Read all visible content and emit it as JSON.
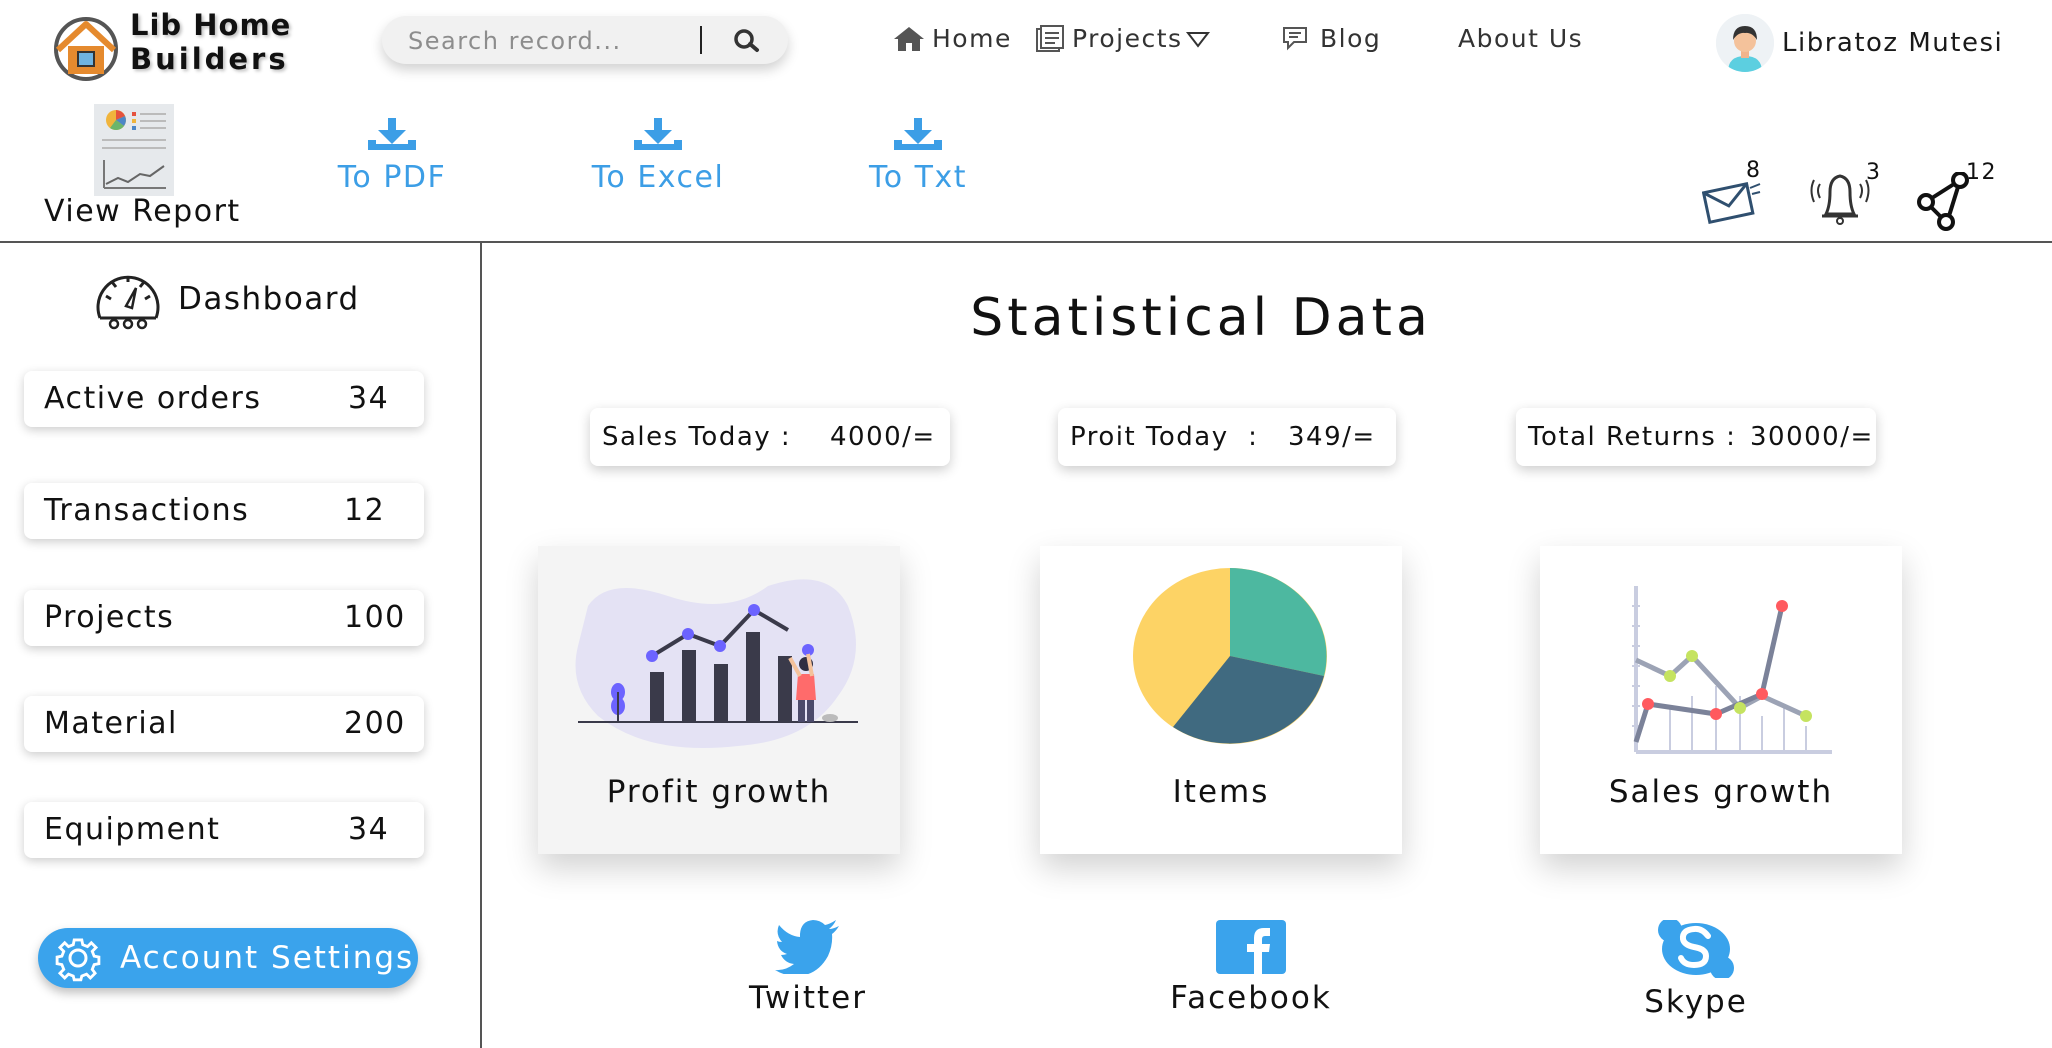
{
  "brand": {
    "line1": "Lib Home",
    "line2": "Builders",
    "icon": "house-logo-icon"
  },
  "search": {
    "placeholder": "Search record...",
    "value": "",
    "icon": "search-icon"
  },
  "nav": {
    "home": "Home",
    "projects": "Projects",
    "blog": "Blog",
    "about": "About Us"
  },
  "user": {
    "name": "Libratoz Mutesi",
    "icon": "user-avatar-icon"
  },
  "toolbar": {
    "view_report": "View Report",
    "exports": [
      "To PDF",
      "To Excel",
      "To Txt"
    ]
  },
  "notifications": {
    "mail": "8",
    "bell": "3",
    "share": "12"
  },
  "sidebar": {
    "title": "Dashboard",
    "items": [
      {
        "label": "Active orders",
        "value": "34"
      },
      {
        "label": "Transactions",
        "value": "12"
      },
      {
        "label": "Projects",
        "value": "100"
      },
      {
        "label": "Material",
        "value": "200"
      },
      {
        "label": "Equipment",
        "value": "34"
      }
    ],
    "account_settings": "Account Settings"
  },
  "main": {
    "title": "Statistical Data",
    "stats": [
      {
        "label": "Sales Today :",
        "value": "4000/="
      },
      {
        "label": "Proit Today  :",
        "value": "349/="
      },
      {
        "label": "Total Returns :",
        "value": "30000/="
      }
    ],
    "cards": [
      "Profit growth",
      "Items",
      "Sales growth"
    ]
  },
  "social": [
    "Twitter",
    "Facebook",
    "Skype"
  ],
  "colors": {
    "accent_blue": "#3aa3ec",
    "export_blue": "#3c9ee6",
    "pie_teal": "#4db8a0",
    "pie_slate": "#406a80",
    "pie_yellow": "#fdd365"
  }
}
